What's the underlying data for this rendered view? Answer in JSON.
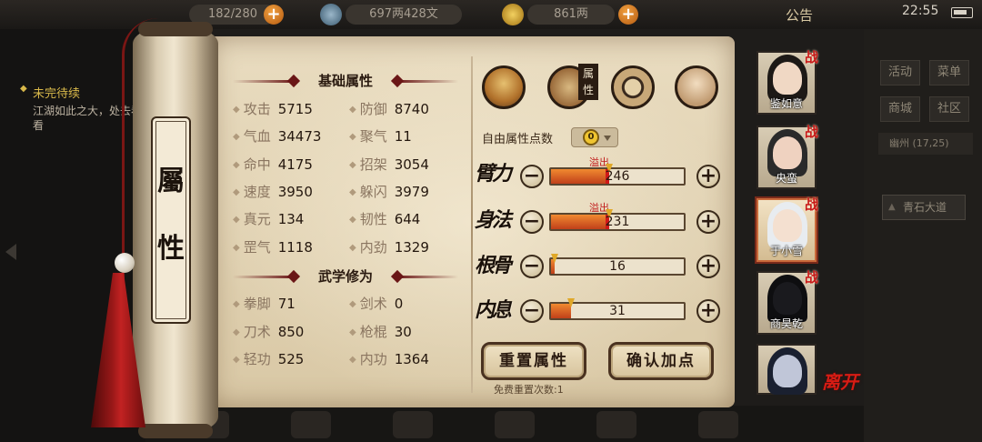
{
  "topbar": {
    "stamina": "182/280",
    "coins": "697两428文",
    "silver": "861两",
    "notice": "公告",
    "time": "22:55"
  },
  "quest": {
    "title": "未完待续",
    "desc": "江湖如此之大，处去看看"
  },
  "scroll": {
    "tab_char1": "屬",
    "tab_char2": "性"
  },
  "basic": {
    "title": "基础属性",
    "stats": [
      {
        "label": "攻击",
        "value": "5715"
      },
      {
        "label": "防御",
        "value": "8740"
      },
      {
        "label": "气血",
        "value": "34473"
      },
      {
        "label": "聚气",
        "value": "11"
      },
      {
        "label": "命中",
        "value": "4175"
      },
      {
        "label": "招架",
        "value": "3054"
      },
      {
        "label": "速度",
        "value": "3950"
      },
      {
        "label": "躲闪",
        "value": "3979"
      },
      {
        "label": "真元",
        "value": "134"
      },
      {
        "label": "韧性",
        "value": "644"
      },
      {
        "label": "罡气",
        "value": "1118"
      },
      {
        "label": "内劲",
        "value": "1329"
      }
    ]
  },
  "martial": {
    "title": "武学修为",
    "stats": [
      {
        "label": "拳脚",
        "value": "71"
      },
      {
        "label": "剑术",
        "value": "0"
      },
      {
        "label": "刀术",
        "value": "850"
      },
      {
        "label": "枪棍",
        "value": "30"
      },
      {
        "label": "轻功",
        "value": "525"
      },
      {
        "label": "内功",
        "value": "1364"
      }
    ]
  },
  "alloc": {
    "attr_tag": "属性",
    "free_label": "自由属性点数",
    "free_points": "0",
    "overflow": "溢出",
    "rows": [
      {
        "name": "臂力",
        "value": "246",
        "fill": 0.44,
        "overflow": true
      },
      {
        "name": "身法",
        "value": "231",
        "fill": 0.44,
        "overflow": true
      },
      {
        "name": "根骨",
        "value": "16",
        "fill": 0.03,
        "overflow": false
      },
      {
        "name": "内息",
        "value": "31",
        "fill": 0.15,
        "overflow": false
      }
    ],
    "reset_label": "重置属性",
    "confirm_label": "确认加点",
    "hint": "免费重置次数:1"
  },
  "party": [
    {
      "name": "鉴如意",
      "battle": "战"
    },
    {
      "name": "央蛮",
      "battle": "战"
    },
    {
      "name": "于小雪",
      "battle": "战"
    },
    {
      "name": "商昊乾",
      "battle": "战"
    },
    {
      "name": "",
      "battle": ""
    }
  ],
  "leave_label": "离开",
  "right_menu": {
    "btn1": "活动",
    "btn2": "菜单",
    "btn3": "商城",
    "btn4": "社区",
    "location": "幽州  (17,25)",
    "road": "青石大道"
  },
  "colors": {
    "accent": "#6a1616",
    "bar_fill": "#e07a2a",
    "overflow_text": "#c01818"
  }
}
